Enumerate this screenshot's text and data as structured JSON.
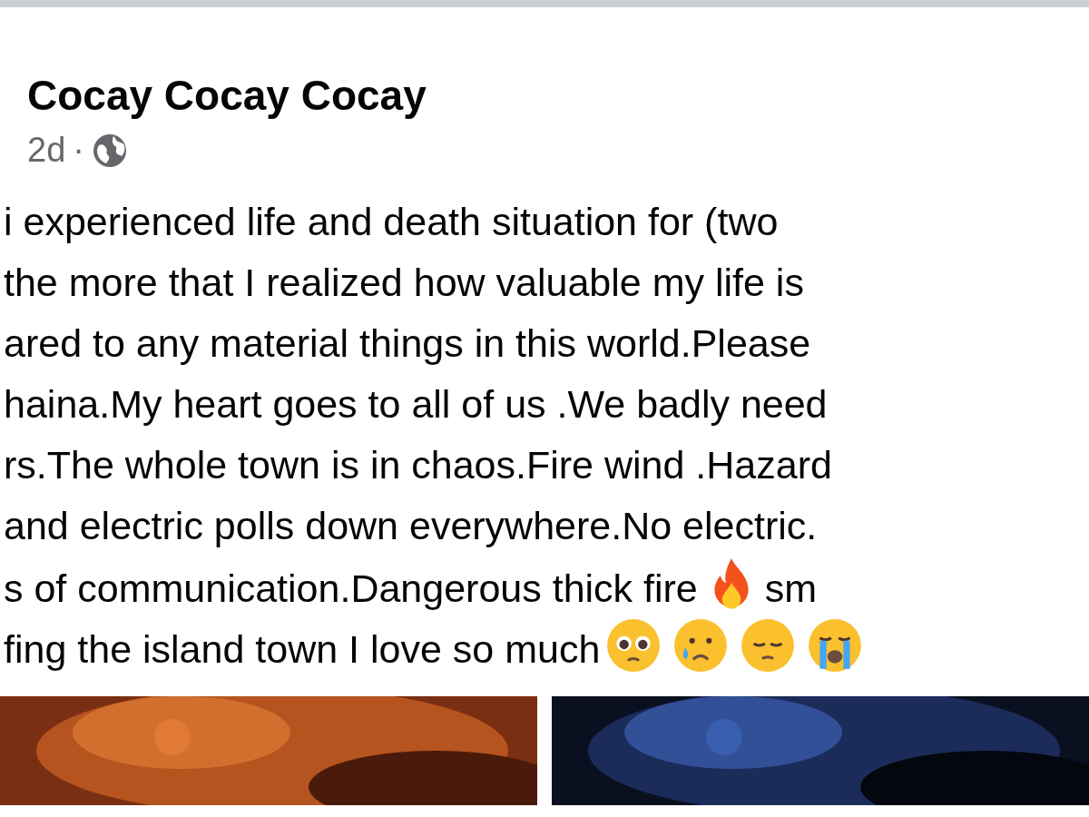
{
  "post": {
    "author": "Cocay Cocay Cocay",
    "time": "2d",
    "separator": "·",
    "lines": [
      {
        "text": "i experienced life and death situation for (two"
      },
      {
        "text": "the more that I realized how valuable my life is"
      },
      {
        "text": "ared to any material things in this world.Please"
      },
      {
        "text": "haina.My heart goes to all of us .We badly need"
      },
      {
        "text": "rs.The whole town is in chaos.Fire wind .Hazard"
      },
      {
        "text": "and electric polls down everywhere.No electric."
      },
      {
        "text": "s of communication.Dangerous thick fire",
        "emojis": [
          {
            "kind": "fire"
          }
        ],
        "after": "sm"
      },
      {
        "text": "fing the island town I love so much",
        "emojis": [
          {
            "kind": "teary"
          },
          {
            "kind": "crying"
          },
          {
            "kind": "pensive"
          },
          {
            "kind": "sobbing"
          }
        ]
      }
    ]
  }
}
